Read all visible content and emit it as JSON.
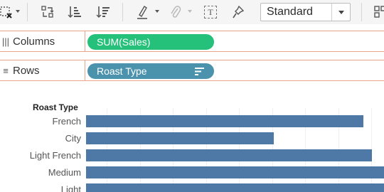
{
  "toolbar": {
    "icons": [
      "clear-sheet-icon",
      "swap-rows-columns-icon",
      "sort-ascending-icon",
      "sort-descending-icon",
      "highlight-icon",
      "attach-icon",
      "show-labels-icon",
      "pin-icon",
      "show-me-icon"
    ],
    "label_icon_text": "T",
    "view_select": {
      "value": "Standard"
    }
  },
  "shelves": {
    "columns": {
      "label": "Columns",
      "icon": "|||",
      "pill": "SUM(Sales)",
      "pill_color": "#25c07a"
    },
    "rows": {
      "label": "Rows",
      "icon": "≡",
      "pill": "Roast Type",
      "pill_color": "#4b93ad"
    }
  },
  "chart_data": {
    "type": "bar",
    "orientation": "horizontal",
    "row_header": "Roast Type",
    "categories": [
      "French",
      "City",
      "Light French",
      "Medium",
      "Light"
    ],
    "values": [
      0.93,
      0.63,
      0.96,
      1.0,
      1.0
    ],
    "bar_color": "#4e79a7",
    "grid": true
  }
}
